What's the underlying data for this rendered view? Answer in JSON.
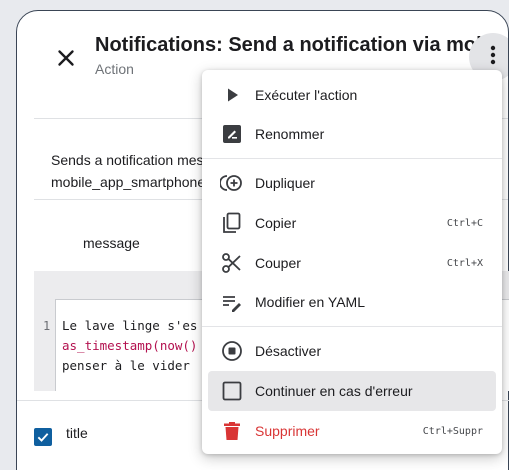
{
  "header": {
    "title": "Notifications: Send a notification via mobi",
    "subtitle": "Action",
    "close_icon": "close-icon",
    "more_icon": "more-vert-icon"
  },
  "description": {
    "line1": "Sends a notification messa",
    "line2": "mobile_app_smartphone_d"
  },
  "fields": {
    "message_label": "message",
    "title_label": "title",
    "title_checked": true
  },
  "code": {
    "line_number": "1",
    "line1": "Le lave linge s'es",
    "line2": "as_timestamp(now()",
    "line3": "penser à le vider"
  },
  "menu": {
    "items": [
      {
        "label": "Exécuter l'action",
        "icon": "play-icon",
        "shortcut": ""
      },
      {
        "label": "Renommer",
        "icon": "rename-icon",
        "shortcut": ""
      },
      {
        "label": "Dupliquer",
        "icon": "duplicate-icon",
        "shortcut": ""
      },
      {
        "label": "Copier",
        "icon": "copy-icon",
        "shortcut": "Ctrl+C"
      },
      {
        "label": "Couper",
        "icon": "scissors-icon",
        "shortcut": "Ctrl+X"
      },
      {
        "label": "Modifier en YAML",
        "icon": "yaml-edit-icon",
        "shortcut": ""
      },
      {
        "label": "Désactiver",
        "icon": "stop-circle-icon",
        "shortcut": ""
      },
      {
        "label": "Continuer en cas d'erreur",
        "icon": "checkbox-blank-icon",
        "shortcut": "",
        "highlighted": true
      },
      {
        "label": "Supprimer",
        "icon": "trash-icon",
        "shortcut": "Ctrl+Suppr",
        "danger": true
      }
    ]
  },
  "colors": {
    "accent": "#0f5f9f",
    "danger": "#d93535",
    "code_string": "#1c1c1f",
    "code_function": "#b3114f"
  }
}
